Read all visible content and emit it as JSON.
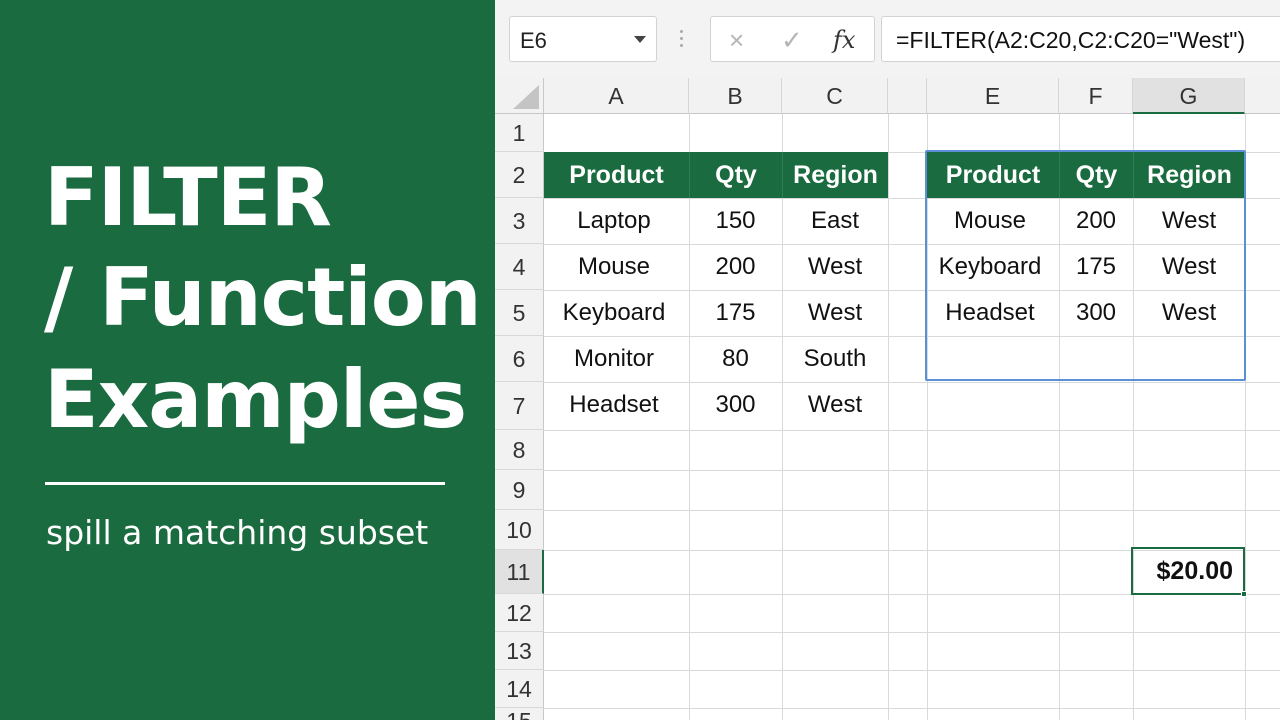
{
  "banner": {
    "title_line1": "FILTER",
    "title_line2": "/ Function /",
    "title_line3": "Examples",
    "subtitle": "spill a matching subset"
  },
  "formula_bar": {
    "name_box": "E6",
    "cancel_icon": "×",
    "enter_icon": "✓",
    "fx_label": "fx",
    "formula": "=FILTER(A2:C20,C2:C20=\"West\")"
  },
  "columns": [
    "A",
    "B",
    "C",
    "E",
    "F",
    "G"
  ],
  "rows": [
    "1",
    "2",
    "3",
    "4",
    "5",
    "6",
    "7",
    "8",
    "9",
    "10",
    "11",
    "12",
    "13",
    "14",
    "15"
  ],
  "source_table": {
    "headers": [
      "Product",
      "Qty",
      "Region"
    ],
    "rows": [
      [
        "Laptop",
        "150",
        "East"
      ],
      [
        "Mouse",
        "200",
        "West"
      ],
      [
        "Keyboard",
        "175",
        "West"
      ],
      [
        "Monitor",
        "80",
        "South"
      ],
      [
        "Headset",
        "300",
        "West"
      ]
    ]
  },
  "result_table": {
    "headers": [
      "Product",
      "Qty",
      "Region"
    ],
    "rows": [
      [
        "Mouse",
        "200",
        "West"
      ],
      [
        "Keyboard",
        "175",
        "West"
      ],
      [
        "Headset",
        "300",
        "West"
      ]
    ]
  },
  "selected_cell_value": "$20.00",
  "colors": {
    "accent": "#1a6b3f",
    "spill_border": "#5b8fd6"
  }
}
